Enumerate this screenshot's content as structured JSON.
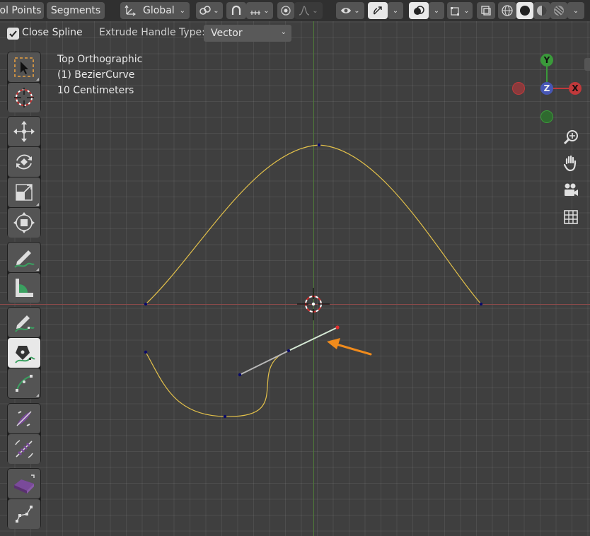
{
  "header": {
    "mode_tab_control_points": "ol Points",
    "mode_tab_segments": "Segments",
    "orientation": "Global"
  },
  "tool_options": {
    "close_spline_label": "Close Spline",
    "close_spline_checked": true,
    "extrude_handle_label": "Extrude Handle Type:",
    "extrude_handle_value": "Vector"
  },
  "viewport": {
    "view_name": "Top Orthographic",
    "object_name": "(1) BezierCurve",
    "scale": "10 Centimeters"
  },
  "gizmo": {
    "y": "Y",
    "z": "Z",
    "x": "X"
  },
  "colors": {
    "curve": "#e2c04a",
    "handle_selected": "#d6ead6",
    "handle": "#b8b8b8",
    "arrow": "#f08b1c",
    "axis_x": "#c0393b",
    "axis_y": "#3a9a3a",
    "axis_z": "#4757b5"
  },
  "toolbar": {
    "tools": [
      "select-box",
      "cursor",
      "move",
      "rotate",
      "scale",
      "transform",
      "annotate",
      "measure",
      "draw",
      "curve-pen",
      "tilt",
      "radius",
      "randomize",
      "extrude",
      "vertex"
    ]
  }
}
